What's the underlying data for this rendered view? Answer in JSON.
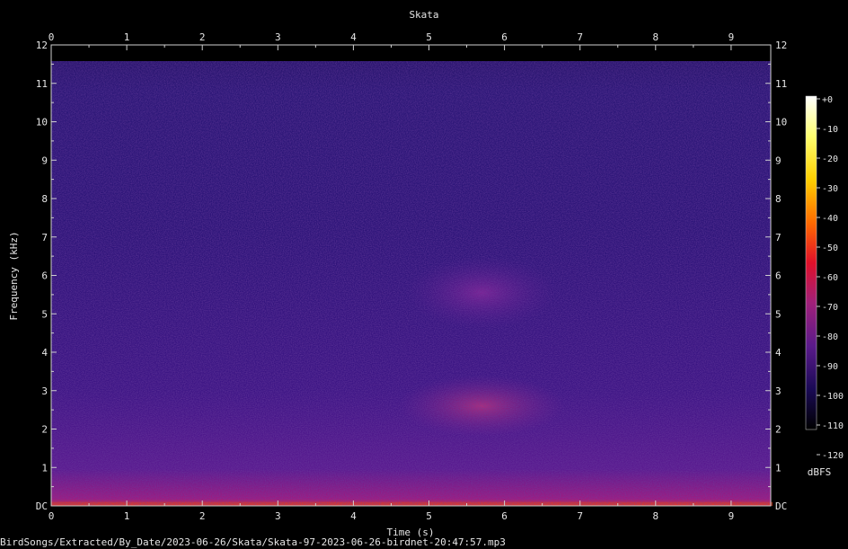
{
  "chart_data": {
    "type": "heatmap",
    "title": "Skata",
    "xlabel": "Time (s)",
    "ylabel": "Frequency (kHz)",
    "xlim": [
      0,
      9.55
    ],
    "ylim": [
      0,
      12
    ],
    "x_ticks": [
      "0",
      "1",
      "2",
      "3",
      "4",
      "5",
      "6",
      "7",
      "8",
      "9"
    ],
    "y_ticks": [
      "DC",
      "1",
      "2",
      "3",
      "4",
      "5",
      "6",
      "7",
      "8",
      "9",
      "10",
      "11",
      "12"
    ],
    "colorbar": {
      "label": "dBFS",
      "ticks": [
        "+0",
        "-10",
        "-20",
        "-30",
        "-40",
        "-50",
        "-60",
        "-70",
        "-80",
        "-90",
        "-100",
        "-110",
        "-120"
      ],
      "range": [
        -120,
        0
      ],
      "colors": [
        "#000000",
        "#1a0a55",
        "#5a1a8a",
        "#a0207a",
        "#e0102a",
        "#ff6a00",
        "#ffd000",
        "#ffff70",
        "#ffffff"
      ]
    },
    "grid": false,
    "energy_regions": [
      {
        "t": [
          4.6,
          6.8
        ],
        "f": [
          1.8,
          3.4
        ],
        "level": "-75 dBFS"
      },
      {
        "t": [
          4.7,
          6.7
        ],
        "f": [
          4.6,
          6.5
        ],
        "level": "-85 dBFS"
      },
      {
        "t": [
          0,
          9.55
        ],
        "f": [
          0,
          0.1
        ],
        "level": "-50 dBFS"
      }
    ]
  },
  "footer": {
    "file_path": "BirdSongs/Extracted/By_Date/2023-06-26/Skata/Skata-97-2023-06-26-birdnet-20:47:57.mp3"
  }
}
